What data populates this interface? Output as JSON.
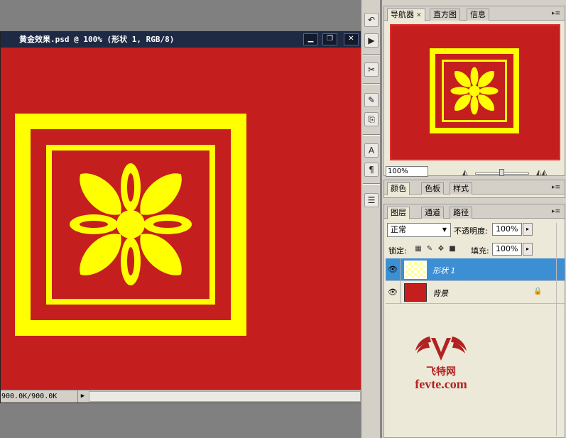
{
  "document": {
    "title": "黄金效果.psd @ 100% (形状 1, RGB/8)",
    "status_info": "900.0K/900.0K",
    "canvas_color": "#c41e1e",
    "ornament_color": "#ffff00"
  },
  "window_buttons": [
    "minimize",
    "restore",
    "close"
  ],
  "tools": [
    "history-brush",
    "actions",
    "tool-presets",
    "brushes",
    "clone-source",
    "character",
    "paragraph",
    "layer-comps"
  ],
  "navigator_panel": {
    "tabs": [
      "导航器",
      "直方图",
      "信息"
    ],
    "zoom_value": "100%"
  },
  "color_panel": {
    "tabs": [
      "颜色",
      "色板",
      "样式"
    ]
  },
  "layers_panel": {
    "tabs": [
      "图层",
      "通道",
      "路径"
    ],
    "blend_mode": "正常",
    "opacity_label": "不透明度:",
    "opacity_value": "100%",
    "lock_label": "锁定:",
    "fill_label": "填充:",
    "fill_value": "100%",
    "layers": [
      {
        "name": "形状 1",
        "selected": true,
        "locked": false
      },
      {
        "name": "背景",
        "selected": false,
        "locked": true
      }
    ]
  },
  "watermark": {
    "brand_cn": "飞特网",
    "brand_url": "fevte.com"
  }
}
